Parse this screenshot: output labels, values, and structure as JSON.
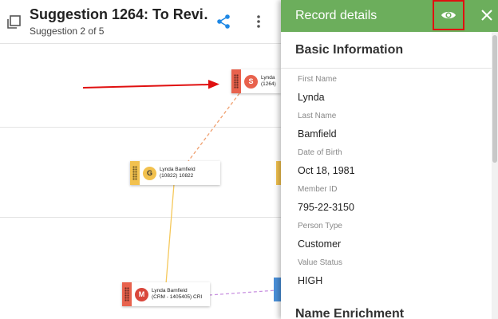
{
  "header": {
    "title": "Suggestion 1264: To Revi…",
    "subtitle": "Suggestion 2 of 5"
  },
  "graph": {
    "nodes": [
      {
        "badge": "S",
        "line1": "Lynda",
        "line2": "(1264)",
        "strip_color": "#e8624d",
        "badge_color": "#e8624d",
        "badge_text_color": "#ffffff"
      },
      {
        "badge": "G",
        "line1": "Lynda Bamfield",
        "line2": "(10822) 10822",
        "strip_color": "#f2c14e",
        "badge_color": "#f2c14e",
        "badge_text_color": "#333333"
      },
      {
        "badge": "M",
        "line1": "Lynda Bamfield",
        "line2": "(CRM - 1405405) CRI",
        "strip_color": "#e8624d",
        "badge_color": "#d9473c",
        "badge_text_color": "#ffffff"
      }
    ],
    "arrow_color": "#e01010",
    "edge_colors": {
      "orange": "#f0a070",
      "yellow": "#f5c85a",
      "purple": "#c890e0"
    }
  },
  "panel": {
    "title": "Record details",
    "header_color": "#6cae5c",
    "section_basic": "Basic Information",
    "section_enrichment": "Name Enrichment",
    "fields": [
      {
        "label": "First Name",
        "value": "Lynda"
      },
      {
        "label": "Last Name",
        "value": "Bamfield"
      },
      {
        "label": "Date of Birth",
        "value": "Oct 18, 1981"
      },
      {
        "label": "Member ID",
        "value": "795-22-3150"
      },
      {
        "label": "Person Type",
        "value": "Customer"
      },
      {
        "label": "Value Status",
        "value": "HIGH"
      }
    ]
  },
  "icons": {
    "copy": "copy-icon",
    "share": "share-icon",
    "more": "more-vert-icon",
    "eye": "eye-icon",
    "close": "close-icon"
  }
}
